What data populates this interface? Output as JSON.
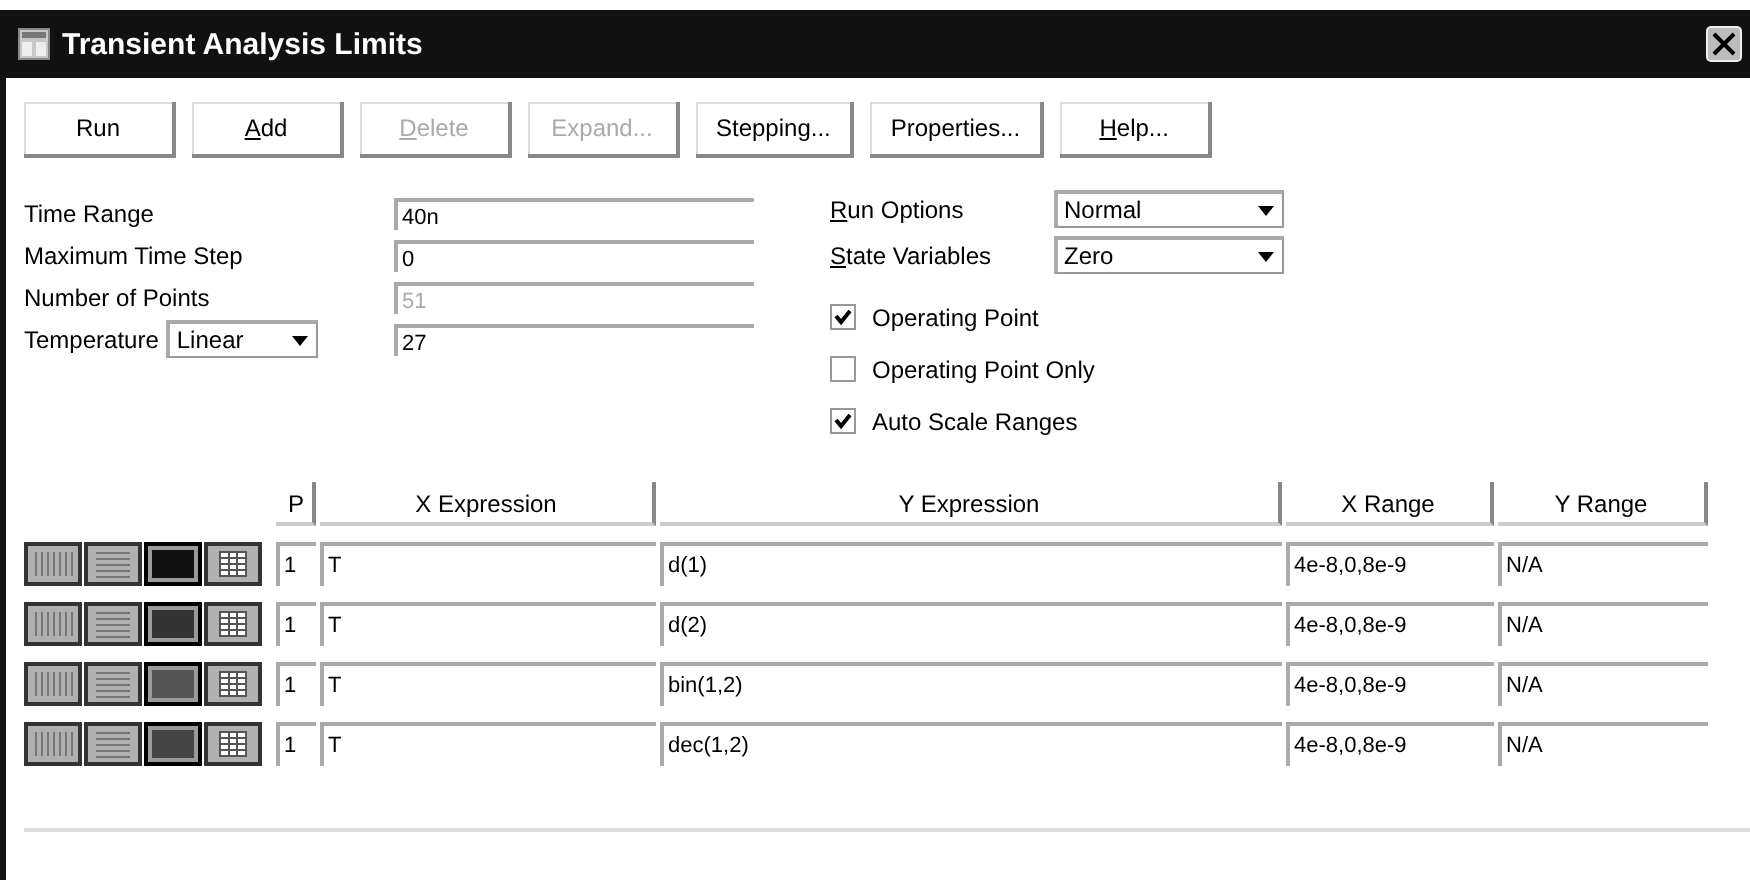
{
  "window": {
    "title": "Transient Analysis Limits"
  },
  "toolbar": [
    {
      "label": "Run",
      "disabled": false
    },
    {
      "label": "Add",
      "underline": true,
      "disabled": false
    },
    {
      "label": "Delete",
      "underline": true,
      "disabled": true
    },
    {
      "label": "Expand...",
      "disabled": true
    },
    {
      "label": "Stepping...",
      "disabled": false
    },
    {
      "label": "Properties...",
      "disabled": false
    },
    {
      "label": "Help...",
      "underline": true,
      "disabled": false
    }
  ],
  "fields": [
    {
      "kind": "text",
      "label": "Time Range",
      "value": "40n",
      "disabled": false
    },
    {
      "kind": "text",
      "label": "Maximum Time Step",
      "value": "0",
      "disabled": false
    },
    {
      "kind": "text",
      "label": "Number of Points",
      "value": "51",
      "disabled": true
    },
    {
      "kind": "mode",
      "label": "Temperature",
      "mode": "Linear",
      "value": "27",
      "disabled": false
    }
  ],
  "options": [
    {
      "label": "Run Options",
      "underline": true,
      "value": "Normal"
    },
    {
      "label": "State Variables",
      "underline": true,
      "value": "Zero"
    }
  ],
  "checkboxes": [
    {
      "label": "Operating Point",
      "checked": true
    },
    {
      "label": "Operating Point Only",
      "checked": false
    },
    {
      "label": "Auto Scale Ranges",
      "checked": true
    }
  ],
  "table": {
    "columns": [
      "P",
      "X Expression",
      "Y Expression",
      "X Range",
      "Y Range"
    ],
    "rows": [
      {
        "color": "#111111",
        "cells": [
          "1",
          "T",
          "d(1)",
          "4e-8,0,8e-9",
          "N/A"
        ]
      },
      {
        "color": "#333333",
        "cells": [
          "1",
          "T",
          "d(2)",
          "4e-8,0,8e-9",
          "N/A"
        ]
      },
      {
        "color": "#555555",
        "cells": [
          "1",
          "T",
          "bin(1,2)",
          "4e-8,0,8e-9",
          "N/A"
        ]
      },
      {
        "color": "#444444",
        "cells": [
          "1",
          "T",
          "dec(1,2)",
          "4e-8,0,8e-9",
          "N/A"
        ]
      }
    ]
  }
}
